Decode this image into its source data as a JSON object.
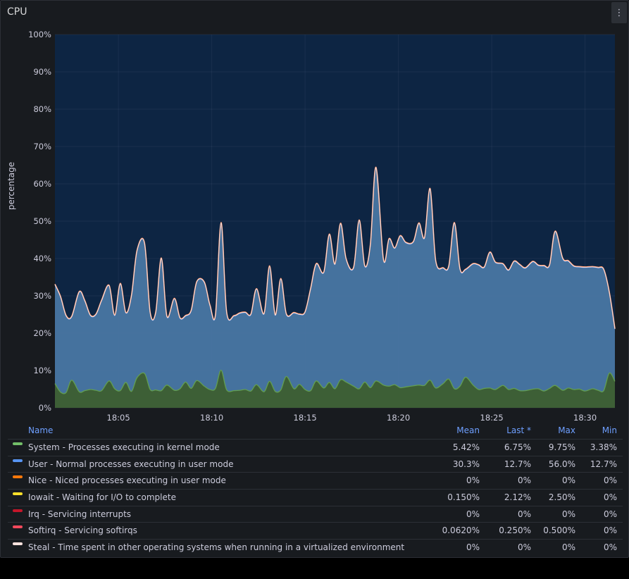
{
  "panel": {
    "title": "CPU",
    "menu_icon": "vertical-ellipsis-icon"
  },
  "chart_data": {
    "type": "area",
    "stacked": true,
    "ylabel": "percentage",
    "ylim": [
      0,
      100
    ],
    "yticks": [
      "0%",
      "10%",
      "20%",
      "30%",
      "40%",
      "50%",
      "60%",
      "70%",
      "80%",
      "90%",
      "100%"
    ],
    "xticks": [
      "18:05",
      "18:10",
      "18:15",
      "18:20",
      "18:25",
      "18:30"
    ],
    "x_minutes_range": [
      1.6,
      31.6
    ],
    "xtick_minutes": [
      5,
      10,
      15,
      20,
      25,
      30
    ],
    "x": [
      1.6,
      1.9,
      2.2,
      2.5,
      2.9,
      3.2,
      3.5,
      3.8,
      4.1,
      4.5,
      4.8,
      5.1,
      5.4,
      5.7,
      6.0,
      6.4,
      6.7,
      7.0,
      7.3,
      7.6,
      8.0,
      8.3,
      8.6,
      8.9,
      9.2,
      9.6,
      9.9,
      10.2,
      10.5,
      10.8,
      11.2,
      11.5,
      11.8,
      12.1,
      12.4,
      12.8,
      13.1,
      13.4,
      13.7,
      14.0,
      14.4,
      14.7,
      15.0,
      15.3,
      15.6,
      16.0,
      16.3,
      16.6,
      16.9,
      17.2,
      17.6,
      17.9,
      18.2,
      18.5,
      18.8,
      19.2,
      19.5,
      19.8,
      20.1,
      20.4,
      20.8,
      21.1,
      21.4,
      21.7,
      22.0,
      22.4,
      22.7,
      23.0,
      23.3,
      23.6,
      24.0,
      24.3,
      24.6,
      24.9,
      25.2,
      25.6,
      25.9,
      26.2,
      26.5,
      26.8,
      27.2,
      27.5,
      27.8,
      28.1,
      28.4,
      28.8,
      29.1,
      29.4,
      29.7,
      30.0,
      30.4,
      30.7,
      31.0,
      31.3,
      31.6
    ],
    "series": [
      {
        "name": "System - Processes executing in kernel mode",
        "color": "#629e51",
        "values": [
          6.5,
          4.2,
          4.1,
          7.4,
          4.3,
          4.6,
          4.9,
          4.7,
          4.6,
          7.2,
          5.1,
          4.6,
          6.8,
          4.4,
          8.1,
          9.2,
          4.9,
          4.8,
          4.6,
          6.1,
          4.7,
          5.1,
          6.9,
          5.2,
          7.3,
          5.8,
          4.9,
          5.2,
          10.1,
          4.8,
          4.6,
          4.7,
          4.9,
          4.5,
          6.2,
          4.3,
          7.1,
          4.4,
          4.8,
          8.4,
          5.1,
          6.3,
          4.9,
          4.6,
          7.2,
          5.3,
          6.8,
          5.1,
          7.5,
          6.9,
          5.8,
          5.1,
          6.9,
          5.4,
          7.2,
          6.1,
          5.8,
          6.2,
          5.4,
          5.6,
          5.9,
          6.1,
          6.0,
          7.4,
          5.3,
          6.5,
          7.7,
          5.1,
          5.8,
          8.2,
          6.1,
          4.9,
          5.2,
          5.3,
          4.9,
          6.0,
          4.9,
          5.2,
          4.6,
          4.6,
          5.0,
          5.1,
          4.5,
          5.2,
          6.0,
          4.7,
          5.3,
          4.9,
          5.0,
          4.5,
          5.1,
          4.7,
          4.6,
          9.3,
          7.1
        ]
      },
      {
        "name": "User - Normal processes executing in user mode",
        "color": "#5794f2",
        "values": [
          26.5,
          25.5,
          20.5,
          17.0,
          26.7,
          24.0,
          19.8,
          20.3,
          24.1,
          25.5,
          19.6,
          28.6,
          18.6,
          25.6,
          34.0,
          34.8,
          20.6,
          20.7,
          35.4,
          18.3,
          24.5,
          18.9,
          17.7,
          20.8,
          26.4,
          27.8,
          22.6,
          19.6,
          39.4,
          20.7,
          20.0,
          20.6,
          20.6,
          20.5,
          25.6,
          20.8,
          30.8,
          20.4,
          29.7,
          16.6,
          20.3,
          18.7,
          20.7,
          27.3,
          31.3,
          30.9,
          39.6,
          33.3,
          41.8,
          32.9,
          31.7,
          45.1,
          31.0,
          38.3,
          57.1,
          33.5,
          39.4,
          36.5,
          40.6,
          38.6,
          38.5,
          43.3,
          39.5,
          51.2,
          34.0,
          30.9,
          30.2,
          44.4,
          31.3,
          28.8,
          32.4,
          33.3,
          32.4,
          36.3,
          34.0,
          32.5,
          31.9,
          34.0,
          33.7,
          32.8,
          34.1,
          33.0,
          33.5,
          33.0,
          41.2,
          35.3,
          34.0,
          33.0,
          32.7,
          33.1,
          32.6,
          32.8,
          32.4,
          21.6,
          14.0
        ]
      },
      {
        "name": "Nice - Niced processes executing in user mode",
        "color": "#ff780a",
        "values": []
      },
      {
        "name": "Iowait - Waiting for I/O to complete",
        "color": "#fade2a",
        "values": []
      },
      {
        "name": "Irq - Servicing interrupts",
        "color": "#c4162a",
        "values": []
      },
      {
        "name": "Softirq - Servicing softirqs",
        "color": "#f2495c",
        "values": []
      },
      {
        "name": "Steal - Time spent in other operating systems when running in a virtualized environment",
        "color": "#fce2de",
        "values": []
      }
    ]
  },
  "legend": {
    "headers": {
      "name": "Name",
      "mean": "Mean",
      "last": "Last *",
      "max": "Max",
      "min": "Min"
    },
    "rows": [
      {
        "name": "System - Processes executing in kernel mode",
        "color": "#73bf69",
        "mean": "5.42%",
        "last": "6.75%",
        "max": "9.75%",
        "min": "3.38%"
      },
      {
        "name": "User - Normal processes executing in user mode",
        "color": "#5794f2",
        "mean": "30.3%",
        "last": "12.7%",
        "max": "56.0%",
        "min": "12.7%"
      },
      {
        "name": "Nice - Niced processes executing in user mode",
        "color": "#ff780a",
        "mean": "0%",
        "last": "0%",
        "max": "0%",
        "min": "0%"
      },
      {
        "name": "Iowait - Waiting for I/O to complete",
        "color": "#fade2a",
        "mean": "0.150%",
        "last": "2.12%",
        "max": "2.50%",
        "min": "0%"
      },
      {
        "name": "Irq - Servicing interrupts",
        "color": "#c4162a",
        "mean": "0%",
        "last": "0%",
        "max": "0%",
        "min": "0%"
      },
      {
        "name": "Softirq - Servicing softirqs",
        "color": "#f2495c",
        "mean": "0.0620%",
        "last": "0.250%",
        "max": "0.500%",
        "min": "0%"
      },
      {
        "name": "Steal - Time spent in other operating systems when running in a virtualized environment",
        "color": "#fce2de",
        "mean": "0%",
        "last": "0%",
        "max": "0%",
        "min": "0%"
      }
    ]
  }
}
